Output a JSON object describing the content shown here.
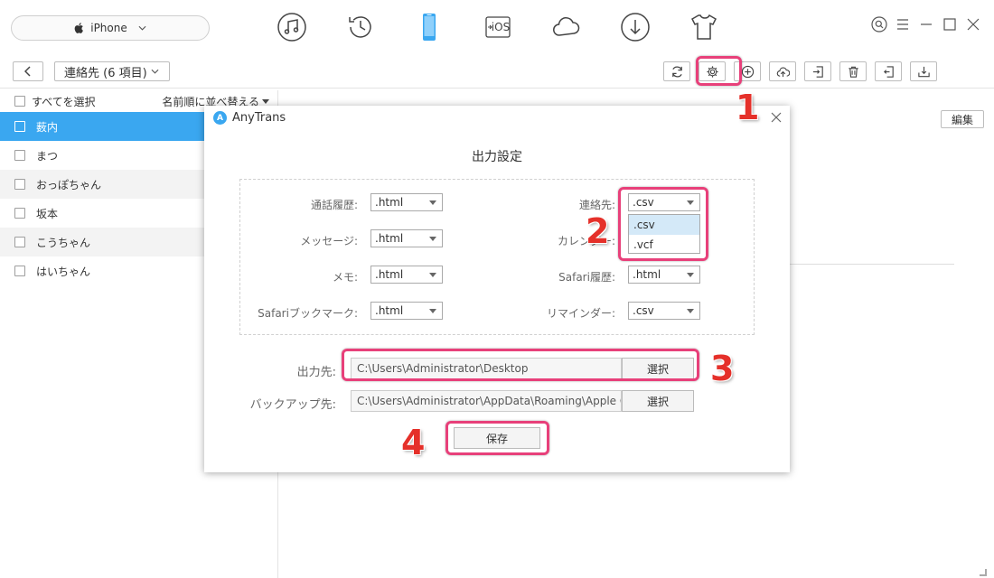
{
  "device": {
    "name": "iPhone"
  },
  "nav": {
    "items": [
      {
        "id": "music",
        "icon": "music-icon"
      },
      {
        "id": "history",
        "icon": "history-icon"
      },
      {
        "id": "device",
        "icon": "phone-icon",
        "active": true
      },
      {
        "id": "ios",
        "icon": "ios-transfer-icon",
        "label": "iOS"
      },
      {
        "id": "cloud",
        "icon": "cloud-icon"
      },
      {
        "id": "download",
        "icon": "download-icon"
      },
      {
        "id": "shirt",
        "icon": "tshirt-icon"
      }
    ]
  },
  "toolbar": {
    "folder_label": "連絡先 (6 項目)",
    "tools": [
      "refresh-icon",
      "gear-icon",
      "add-icon",
      "cloud-upload-icon",
      "export-icon",
      "trash-icon",
      "import-icon",
      "transfer-icon"
    ]
  },
  "sidebar": {
    "select_all": "すべてを選択",
    "sort": "名前順に並べ替える",
    "contacts": [
      {
        "name": "薮内",
        "selected": true
      },
      {
        "name": "まつ"
      },
      {
        "name": "おっぽちゃん"
      },
      {
        "name": "坂本"
      },
      {
        "name": "こうちゃん"
      },
      {
        "name": "はいちゃん"
      }
    ]
  },
  "content": {
    "edit_label": "編集"
  },
  "dialog": {
    "title": "AnyTrans",
    "logo_text": "A",
    "heading": "出力設定",
    "options": [
      {
        "label": "通話履歴:",
        "value": ".html"
      },
      {
        "label": "連絡先:",
        "value": ".csv"
      },
      {
        "label": "メッセージ:",
        "value": ".html"
      },
      {
        "label": "カレンダー:",
        "value": ""
      },
      {
        "label": "メモ:",
        "value": ".html"
      },
      {
        "label": "Safari履歴:",
        "value": ".html"
      },
      {
        "label": "Safariブックマーク:",
        "value": ".html"
      },
      {
        "label": "リマインダー:",
        "value": ".csv"
      }
    ],
    "dropdown_options": [
      ".csv",
      ".vcf"
    ],
    "output_label": "出力先:",
    "output_path": "C:\\Users\\Administrator\\Desktop",
    "backup_label": "バックアップ先:",
    "backup_path": "C:\\Users\\Administrator\\AppData\\Roaming\\Apple Computer\\MobileSync\\Backup",
    "choose_label": "選択",
    "save_label": "保存"
  },
  "annotations": [
    "1",
    "2",
    "3",
    "4"
  ],
  "colors": {
    "accent": "#3aa7f0",
    "highlight": "#e8407a",
    "step_number": "#e5302a"
  }
}
